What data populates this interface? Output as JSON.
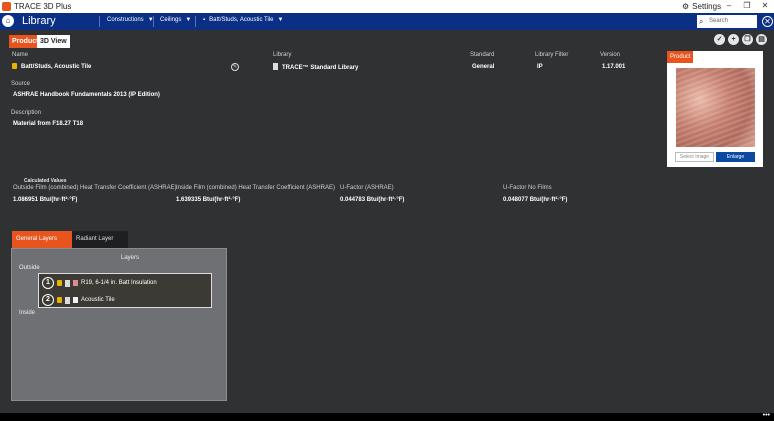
{
  "window": {
    "title": "TRACE 3D Plus",
    "settings_label": "Settings",
    "minimize_glyph": "–",
    "maximize_glyph": "❐",
    "close_glyph": "✕"
  },
  "nav": {
    "brand": "Library",
    "breadcrumbs": [
      "Constructions",
      "Ceilings",
      "Batt/Studs, Acoustic Tile"
    ],
    "search_placeholder": "Search"
  },
  "tabs": {
    "product": "Product",
    "view3d": "3D View"
  },
  "toolbar_icons": [
    "check-circle-icon",
    "add-circle-icon",
    "copy-circle-icon",
    "delete-circle-icon"
  ],
  "fields": {
    "name_label": "Name",
    "name_value": "Batt/Studs, Acoustic Tile",
    "library_label": "Library",
    "library_value": "TRACE™ Standard Library",
    "standard_label": "Standard",
    "standard_value": "General",
    "filter_label": "Library Filter",
    "filter_value": "IP",
    "version_label": "Version",
    "version_value": "1.17.001",
    "source_label": "Source",
    "source_value": "ASHRAE Handbook Fundamentals 2013 (IP Edition)",
    "description_label": "Description",
    "description_value": "Material from F18.27 T18"
  },
  "product_panel": {
    "header": "Product",
    "select_image": "Select Image",
    "enlarge": "Enlarge"
  },
  "calculated": {
    "heading": "Calculated Values",
    "items": [
      {
        "label": "Outside Film (combined) Heat Transfer Coefficient (ASHRAE)",
        "value": "1.086951 Btu/(hr·ft²·°F)"
      },
      {
        "label": "Inside Film (combined) Heat Transfer Coefficient (ASHRAE)",
        "value": "1.639335 Btu/(hr·ft²·°F)"
      },
      {
        "label": "U-Factor (ASHRAE)",
        "value": "0.044783 Btu/(hr·ft²·°F)"
      },
      {
        "label": "U-Factor No Films",
        "value": "0.048077 Btu/(hr·ft²·°F)"
      }
    ]
  },
  "layers": {
    "tab_general": "General Layers",
    "tab_radiant": "Radiant Layer",
    "title": "Layers",
    "outside_label": "Outside",
    "inside_label": "Inside",
    "items": [
      {
        "num": "1",
        "name": "R19, 6-1/4 in. Batt Insulation",
        "swatch": "#e08a8a"
      },
      {
        "num": "2",
        "name": "Acoustic Tile",
        "swatch": "#f2f2f2"
      }
    ]
  },
  "colors": {
    "accent": "#e8541d",
    "nav": "#0b2f85",
    "background": "#2f3133"
  },
  "status_more": "•••"
}
